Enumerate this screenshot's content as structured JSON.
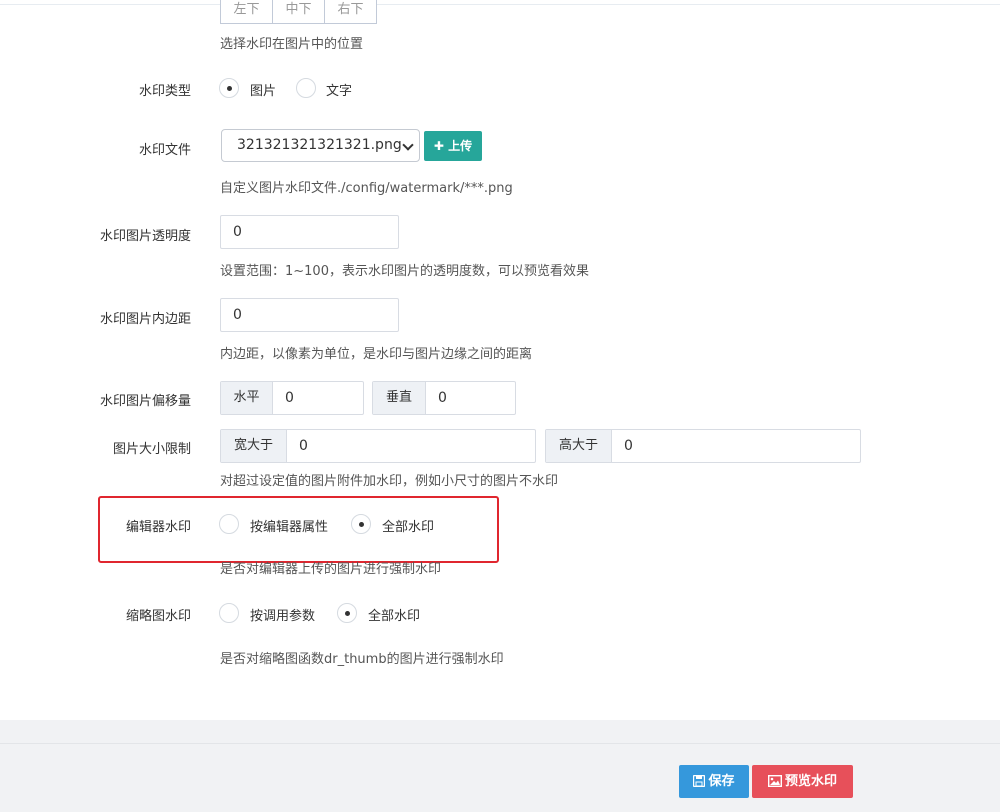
{
  "position": {
    "buttons": [
      "左下",
      "中下",
      "右下"
    ],
    "help": "选择水印在图片中的位置"
  },
  "watermark_type": {
    "label": "水印类型",
    "options": [
      "图片",
      "文字"
    ],
    "selected": "图片"
  },
  "watermark_file": {
    "label": "水印文件",
    "value": "321321321321321.png",
    "upload_label": "上传",
    "help": "自定义图片水印文件./config/watermark/***.png"
  },
  "opacity": {
    "label": "水印图片透明度",
    "value": "0",
    "help": "设置范围：1~100，表示水印图片的透明度数，可以预览看效果"
  },
  "padding": {
    "label": "水印图片内边距",
    "value": "0",
    "help": "内边距，以像素为单位，是水印与图片边缘之间的距离"
  },
  "offset": {
    "label": "水印图片偏移量",
    "horizontal_label": "水平",
    "horizontal_value": "0",
    "vertical_label": "垂直",
    "vertical_value": "0"
  },
  "size_limit": {
    "label": "图片大小限制",
    "width_label": "宽大于",
    "width_value": "0",
    "height_label": "高大于",
    "height_value": "0",
    "help": "对超过设定值的图片附件加水印，例如小尺寸的图片不水印"
  },
  "editor_watermark": {
    "label": "编辑器水印",
    "options": [
      "按编辑器属性",
      "全部水印"
    ],
    "selected": "全部水印",
    "help": "是否对编辑器上传的图片进行强制水印"
  },
  "thumb_watermark": {
    "label": "缩略图水印",
    "options": [
      "按调用参数",
      "全部水印"
    ],
    "selected": "全部水印",
    "help": "是否对缩略图函数dr_thumb的图片进行强制水印"
  },
  "footer": {
    "save_label": "保存",
    "preview_label": "预览水印"
  },
  "colors": {
    "upload": "#26a69a",
    "save": "#3598dc",
    "preview": "#e7505a",
    "highlight": "#e0262f"
  }
}
